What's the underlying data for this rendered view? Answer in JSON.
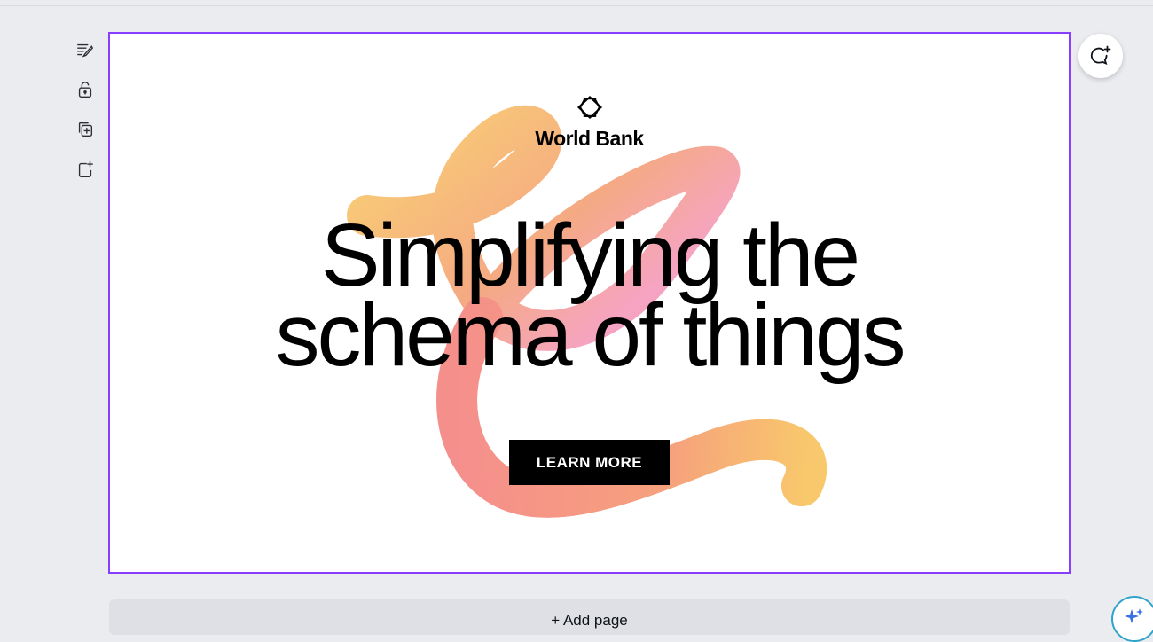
{
  "design": {
    "brand_name": "World Bank",
    "headline_line1": "Simplifying the",
    "headline_line2": "schema of things",
    "cta_label": "LEARN MORE"
  },
  "footer": {
    "add_page_label": "+ Add page"
  },
  "toolbar": {
    "items": [
      {
        "icon": "edit-notes-icon"
      },
      {
        "icon": "lock-icon"
      },
      {
        "icon": "duplicate-icon"
      },
      {
        "icon": "add-page-icon"
      }
    ]
  },
  "colors": {
    "canvas_bg": "#ebecf0",
    "selection_border": "#8b3dff",
    "cta_bg": "#000000",
    "ribbon_start": "#f9c96a",
    "ribbon_mid": "#f4968a",
    "ribbon_pink": "#f59fc0"
  }
}
